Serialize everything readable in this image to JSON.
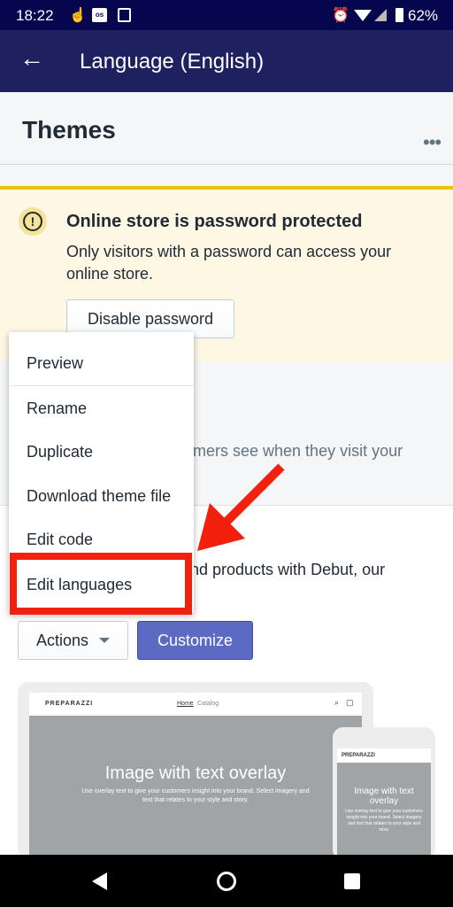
{
  "status_bar": {
    "time": "18:22",
    "notif_icons": [
      "touch-icon",
      "os-icon",
      "maps-icon"
    ],
    "battery": "62%"
  },
  "app_bar": {
    "title": "Language (English)"
  },
  "page": {
    "title": "Themes"
  },
  "banner": {
    "title": "Online store is password protected",
    "body": "Only visitors with a password can access your online store.",
    "button": "Disable password",
    "accent": "#eec200"
  },
  "section": {
    "partial_text": "mers see when they visit your"
  },
  "card": {
    "partial_text": "nd products with Debut, our",
    "actions_label": "Actions",
    "customize_label": "Customize",
    "accent": "#5c6ac4"
  },
  "menu": {
    "items": [
      "Preview",
      "Rename",
      "Duplicate",
      "Download theme file",
      "Edit code",
      "Edit languages"
    ],
    "highlight_color": "#f3200d"
  },
  "preview": {
    "brand": "PREPARAZZI",
    "nav": [
      "Home",
      "Catalog"
    ],
    "heading": "Image with text overlay",
    "subtext": "Use overlay text to give your customers insight into your brand. Select imagery and text that relates to your style and story.",
    "mobile_heading": "Image with text overlay",
    "mobile_subtext": "Use overlay text to give your customers insight into your brand. Select imagery and text that relates to your style and story."
  }
}
